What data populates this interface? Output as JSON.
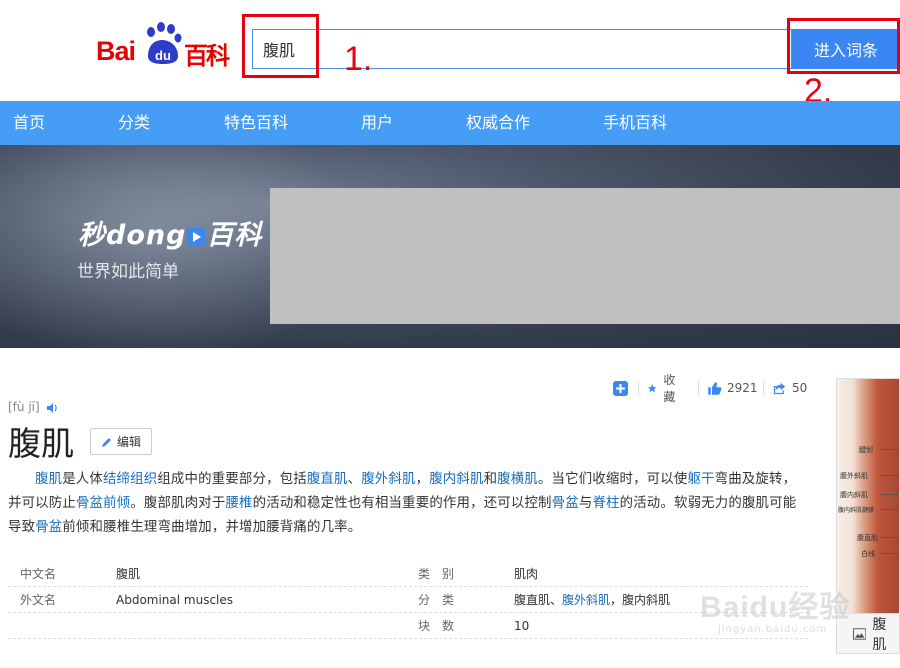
{
  "header": {
    "logo_text_left": "Bai",
    "logo_text_paw": "du",
    "logo_text_right": "百科",
    "search_value": "腹肌",
    "search_button": "进入词条",
    "annotation_1": "1.",
    "annotation_2": "2."
  },
  "nav": {
    "items": [
      "首页",
      "分类",
      "特色百科",
      "用户",
      "权威合作",
      "手机百科"
    ]
  },
  "banner": {
    "logo_part1": "秒dong",
    "logo_part2": "百科",
    "slogan": "世界如此简单"
  },
  "actions": {
    "collect_label": "收藏",
    "like_count": "2921",
    "share_count": "50"
  },
  "entry": {
    "pinyin": "[fù jī]",
    "title": "腹肌",
    "edit_label": "编辑",
    "paragraph": [
      {
        "t": "腹肌",
        "link": true
      },
      {
        "t": "是人体",
        "link": false
      },
      {
        "t": "结缔组织",
        "link": true
      },
      {
        "t": "组成中的重要部分，包括",
        "link": false
      },
      {
        "t": "腹直肌",
        "link": true
      },
      {
        "t": "、",
        "link": false
      },
      {
        "t": "腹外斜肌",
        "link": true
      },
      {
        "t": "，",
        "link": false
      },
      {
        "t": "腹内斜肌",
        "link": true
      },
      {
        "t": "和",
        "link": false
      },
      {
        "t": "腹横肌",
        "link": true
      },
      {
        "t": "。当它们收缩时，可以使",
        "link": false
      },
      {
        "t": "躯干",
        "link": true
      },
      {
        "t": "弯曲及旋转，并可以防止",
        "link": false
      },
      {
        "t": "骨盆前倾",
        "link": true
      },
      {
        "t": "。腹部肌肉对于",
        "link": false
      },
      {
        "t": "腰椎",
        "link": true
      },
      {
        "t": "的活动和稳定性也有相当重要的作用，还可以控制",
        "link": false
      },
      {
        "t": "骨盆",
        "link": true
      },
      {
        "t": "与",
        "link": false
      },
      {
        "t": "脊柱",
        "link": true
      },
      {
        "t": "的活动。软弱无力的腹肌可能导致",
        "link": false
      },
      {
        "t": "骨盆",
        "link": true
      },
      {
        "t": "前倾和腰椎生理弯曲增加，并增加腰背痛的几率。",
        "link": false
      }
    ]
  },
  "info": {
    "rows": [
      {
        "k1": "中文名",
        "v1": "腹肌",
        "k2": "类　别",
        "v2": "肌肉"
      },
      {
        "k1": "外文名",
        "v1": "Abdominal muscles",
        "k2": "分　类"
      },
      {
        "k1": "",
        "v1": "",
        "k2": "块　数",
        "v2": "10"
      }
    ],
    "classify_parts": [
      {
        "t": "腹直肌、",
        "link": false
      },
      {
        "t": "腹外斜肌",
        "link": true
      },
      {
        "t": "，腹内斜肌",
        "link": false
      }
    ]
  },
  "side_image": {
    "labels": [
      "腱划",
      "腹外斜肌",
      "腹内斜肌",
      "腹内斜肌腱膜",
      "腹直肌",
      "白线"
    ],
    "caption": "腹肌"
  },
  "watermark": {
    "line1": "Baidu经验",
    "line2": "jingyan.baidu.com"
  },
  "colors": {
    "nav_bg": "#459df5",
    "button_bg": "#3a86f3",
    "link": "#136ec2",
    "annotation": "#e60012",
    "logo_red": "#e10601"
  }
}
